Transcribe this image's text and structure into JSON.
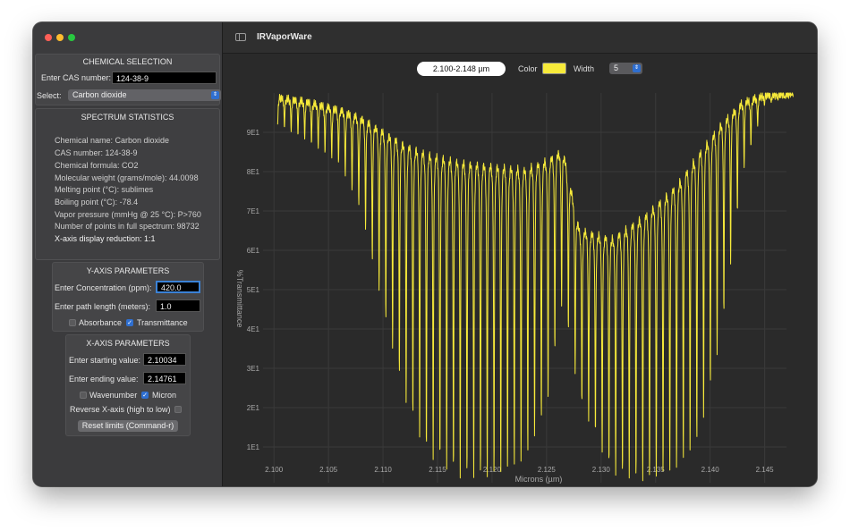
{
  "window": {
    "app_title": "IRVaporWare"
  },
  "chemical_selection": {
    "title": "CHEMICAL SELECTION",
    "cas_label": "Enter CAS number:",
    "cas_value": "124-38-9",
    "select_label": "Select:",
    "select_value": "Carbon dioxide"
  },
  "spectrum_statistics": {
    "title": "SPECTRUM STATISTICS",
    "lines": [
      "Chemical name: Carbon dioxide",
      "CAS number: 124-38-9",
      "Chemical formula: CO2",
      "Molecular weight (grams/mole): 44.0098",
      "Melting point (°C): sublimes",
      "Boiling point (°C): -78.4",
      "Vapor pressure (mmHg @ 25 °C): P>760",
      "Number of points in full spectrum: 98732",
      "X-axis display reduction: 1:1"
    ]
  },
  "y_axis_params": {
    "title": "Y-AXIS PARAMETERS",
    "concentration_label": "Enter Concentration (ppm):",
    "concentration_value": "420.0",
    "path_label": "Enter path length (meters):",
    "path_value": "1.0",
    "absorbance_label": "Absorbance",
    "absorbance_checked": false,
    "transmittance_label": "Transmittance",
    "transmittance_checked": true
  },
  "x_axis_params": {
    "title": "X-AXIS PARAMETERS",
    "start_label": "Enter starting value:",
    "start_value": "2.10034",
    "end_label": "Enter ending value:",
    "end_value": "2.14761",
    "wavenumber_label": "Wavenumber",
    "wavenumber_checked": false,
    "micron_label": "Micron",
    "micron_checked": true,
    "reverse_label": "Reverse X-axis (high to low)",
    "reverse_checked": false,
    "reset_button": "Reset limits (Command-r)"
  },
  "toolbar": {
    "range_label": "2.100-2.148 µm",
    "color_label": "Color",
    "color_value": "#f7ea3a",
    "width_label": "Width",
    "width_value": "5"
  },
  "chart_data": {
    "type": "line",
    "xlabel": "Microns (µm)",
    "ylabel": "%Transmittance",
    "xlim": [
      2.099,
      2.147
    ],
    "ylim": [
      0,
      100
    ],
    "x_ticks": [
      "2.100",
      "2.105",
      "2.110",
      "2.115",
      "2.120",
      "2.125",
      "2.130",
      "2.135",
      "2.140",
      "2.145"
    ],
    "y_ticks": [
      "1E1",
      "2E1",
      "3E1",
      "4E1",
      "5E1",
      "6E1",
      "7E1",
      "8E1",
      "9E1"
    ],
    "grid": true,
    "line_color": "#f7ea3a",
    "series": [
      {
        "x_start": 2.10034,
        "x_end": 2.14761,
        "line_spacing": 0.00062,
        "envelope_x": [
          2.10034,
          2.103,
          2.106,
          2.108,
          2.11,
          2.112,
          2.114,
          2.117,
          2.12,
          2.123,
          2.125,
          2.1265,
          2.128,
          2.131,
          2.134,
          2.137,
          2.139,
          2.141,
          2.143,
          2.145,
          2.14761
        ],
        "envelope_min": [
          92,
          88,
          82,
          70,
          45,
          22,
          8,
          2,
          2,
          6,
          20,
          48,
          22,
          3,
          1,
          4,
          12,
          38,
          80,
          97,
          99.5
        ],
        "envelope_max": [
          99,
          98,
          96,
          94,
          91,
          88,
          86,
          84,
          83,
          82,
          84,
          86,
          66,
          64,
          70,
          78,
          86,
          93,
          98,
          99.5,
          99.8
        ]
      }
    ]
  }
}
